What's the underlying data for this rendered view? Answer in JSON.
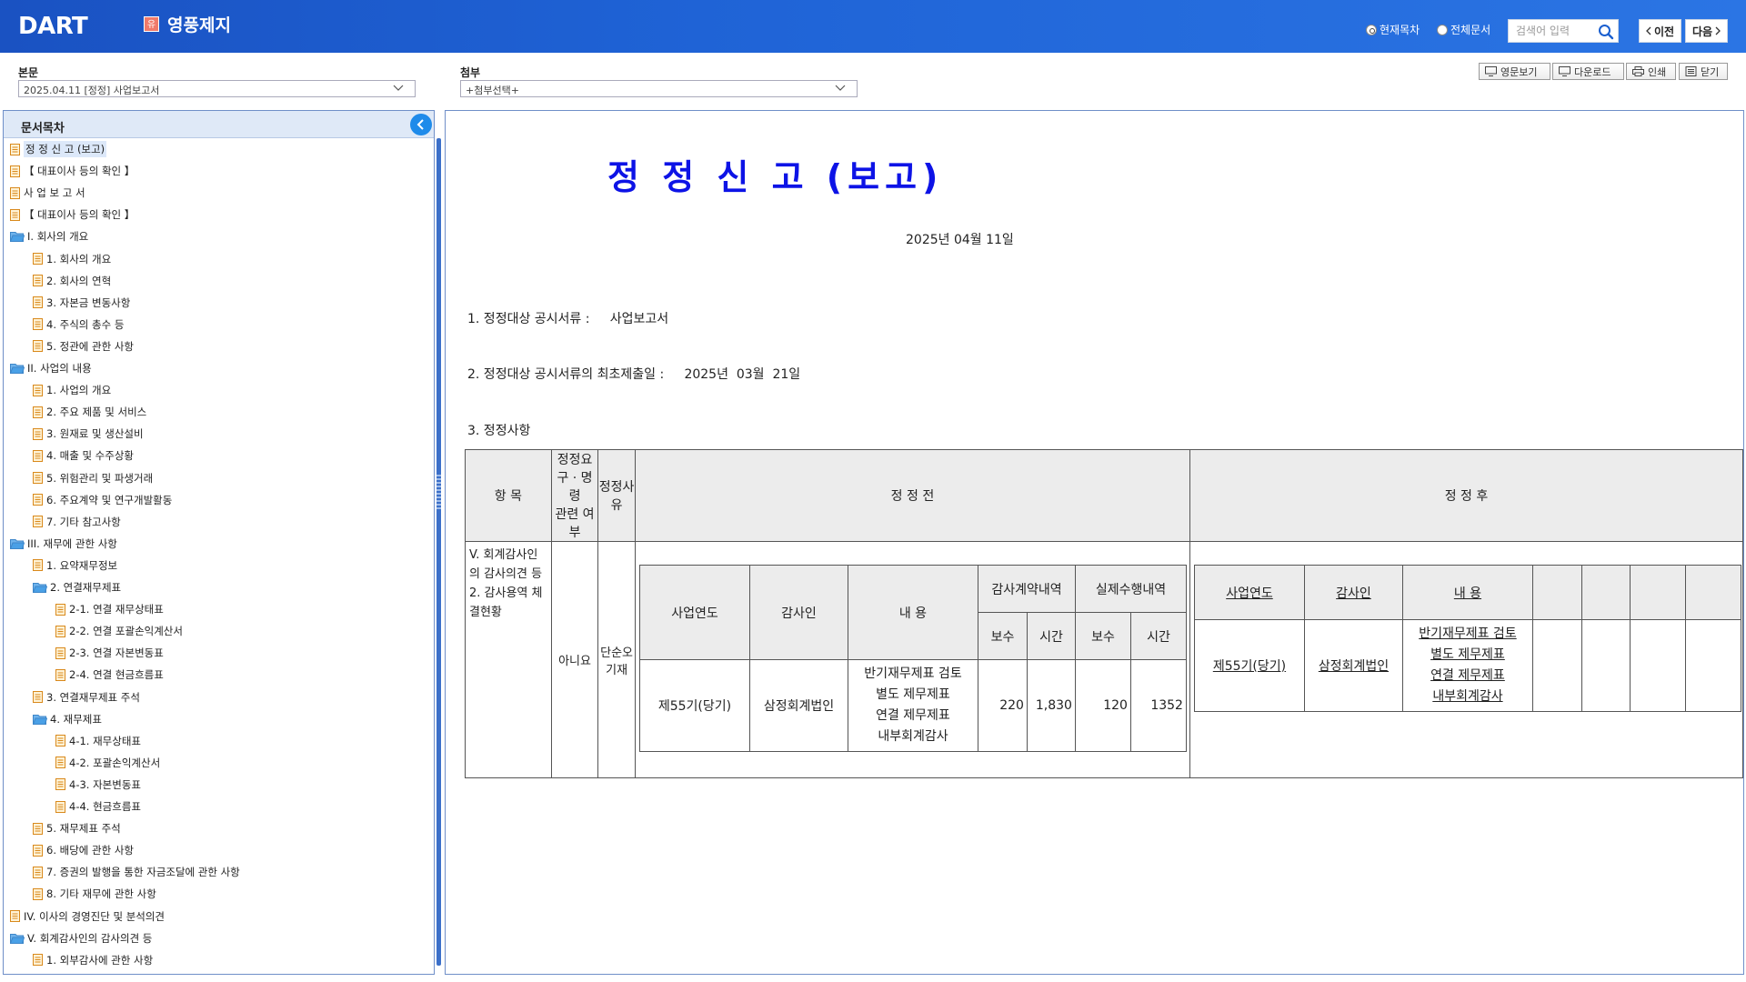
{
  "header": {
    "logo_text": "DART",
    "corp_badge": "유",
    "corp_name": "영풍제지",
    "radio_current": "현재목차",
    "radio_all": "전체문서",
    "search_placeholder": "검색어 입력",
    "prev_label": "이전",
    "next_label": "다음"
  },
  "selectors": {
    "main_label": "본문",
    "main_value": "2025.04.11 [정정] 사업보고서",
    "attach_label": "첨부",
    "attach_value": "+첨부선택+"
  },
  "toolbar": {
    "english": "영문보기",
    "download": "다운로드",
    "print": "인쇄",
    "close": "닫기"
  },
  "toc": {
    "title": "문서목차",
    "items": [
      {
        "label": "정 정 신 고 (보고)",
        "level": 0,
        "type": "doc",
        "selected": true
      },
      {
        "label": "【 대표이사 등의 확인 】",
        "level": 0,
        "type": "doc"
      },
      {
        "label": "사 업 보 고 서",
        "level": 0,
        "type": "doc"
      },
      {
        "label": "【 대표이사 등의 확인 】",
        "level": 0,
        "type": "doc"
      },
      {
        "label": "I. 회사의 개요",
        "level": 0,
        "type": "folder"
      },
      {
        "label": "1. 회사의 개요",
        "level": 1,
        "type": "doc"
      },
      {
        "label": "2. 회사의 연혁",
        "level": 1,
        "type": "doc"
      },
      {
        "label": "3. 자본금 변동사항",
        "level": 1,
        "type": "doc"
      },
      {
        "label": "4. 주식의 총수 등",
        "level": 1,
        "type": "doc"
      },
      {
        "label": "5. 정관에 관한 사항",
        "level": 1,
        "type": "doc"
      },
      {
        "label": "II. 사업의 내용",
        "level": 0,
        "type": "folder"
      },
      {
        "label": "1. 사업의 개요",
        "level": 1,
        "type": "doc"
      },
      {
        "label": "2. 주요 제품 및 서비스",
        "level": 1,
        "type": "doc"
      },
      {
        "label": "3. 원재료 및 생산설비",
        "level": 1,
        "type": "doc"
      },
      {
        "label": "4. 매출 및 수주상황",
        "level": 1,
        "type": "doc"
      },
      {
        "label": "5. 위험관리 및 파생거래",
        "level": 1,
        "type": "doc"
      },
      {
        "label": "6. 주요계약 및 연구개발활동",
        "level": 1,
        "type": "doc"
      },
      {
        "label": "7. 기타 참고사항",
        "level": 1,
        "type": "doc"
      },
      {
        "label": "III. 재무에 관한 사항",
        "level": 0,
        "type": "folder"
      },
      {
        "label": "1. 요약재무정보",
        "level": 1,
        "type": "doc"
      },
      {
        "label": "2. 연결재무제표",
        "level": 1,
        "type": "folder"
      },
      {
        "label": "2-1. 연결 재무상태표",
        "level": 2,
        "type": "doc"
      },
      {
        "label": "2-2. 연결 포괄손익계산서",
        "level": 2,
        "type": "doc"
      },
      {
        "label": "2-3. 연결 자본변동표",
        "level": 2,
        "type": "doc"
      },
      {
        "label": "2-4. 연결 현금흐름표",
        "level": 2,
        "type": "doc"
      },
      {
        "label": "3. 연결재무제표 주석",
        "level": 1,
        "type": "doc"
      },
      {
        "label": "4. 재무제표",
        "level": 1,
        "type": "folder"
      },
      {
        "label": "4-1. 재무상태표",
        "level": 2,
        "type": "doc"
      },
      {
        "label": "4-2. 포괄손익계산서",
        "level": 2,
        "type": "doc"
      },
      {
        "label": "4-3. 자본변동표",
        "level": 2,
        "type": "doc"
      },
      {
        "label": "4-4. 현금흐름표",
        "level": 2,
        "type": "doc"
      },
      {
        "label": "5. 재무제표 주석",
        "level": 1,
        "type": "doc"
      },
      {
        "label": "6. 배당에 관한 사항",
        "level": 1,
        "type": "doc"
      },
      {
        "label": "7. 증권의 발행을 통한 자금조달에 관한 사항",
        "level": 1,
        "type": "doc"
      },
      {
        "label": "8. 기타 재무에 관한 사항",
        "level": 1,
        "type": "doc"
      },
      {
        "label": "IV. 이사의 경영진단 및 분석의견",
        "level": 0,
        "type": "doc"
      },
      {
        "label": "V. 회계감사인의 감사의견 등",
        "level": 0,
        "type": "folder"
      },
      {
        "label": "1. 외부감사에 관한 사항",
        "level": 1,
        "type": "doc"
      }
    ]
  },
  "document": {
    "title": "정 정 신 고 (보고)",
    "date": "2025년 04월 11일",
    "line1": "1. 정정대상 공시서류 :     사업보고서",
    "line2": "2. 정정대상 공시서류의 최초제출일 :     2025년  03월  21일",
    "line3": "3. 정정사항",
    "table": {
      "headers": {
        "item": "항  목",
        "related_1": "정정요구 · 명령",
        "related_2": "관련 여부",
        "reason": "정정사유",
        "before": "정 정 전",
        "after": "정 정 후"
      },
      "row": {
        "item_1": "V. 회계감사인의 감사의견 등",
        "item_2": "2. 감사용역 체결현황",
        "related": "아니요",
        "reason": "단순오기재"
      },
      "inner_headers": {
        "year": "사업연도",
        "auditor": "감사인",
        "content": "내 용",
        "contract": "감사계약내역",
        "actual": "실제수행내역",
        "fee": "보수",
        "hours": "시간"
      },
      "before": {
        "year": "제55기(당기)",
        "auditor": "삼정회계법인",
        "content": [
          "반기재무제표 검토",
          "별도 제무제표",
          "연결 제무제표",
          "내부회계감사"
        ],
        "contract_fee": "220",
        "contract_hours": "1,830",
        "actual_fee": "120",
        "actual_hours": "1352"
      },
      "after": {
        "year": "제55기(당기)",
        "auditor": "삼정회계법인",
        "content": [
          "반기재무제표 검토",
          "별도 제무제표",
          "연결 제무제표",
          "내부회계감사"
        ]
      }
    }
  }
}
